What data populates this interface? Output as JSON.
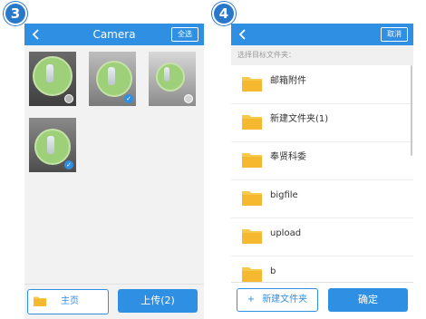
{
  "steps": {
    "left": "3",
    "right": "4"
  },
  "camera_screen": {
    "title": "Camera",
    "select_all": "全选",
    "photos": [
      {
        "selected": false
      },
      {
        "selected": true
      },
      {
        "selected": false
      },
      {
        "selected": true
      }
    ],
    "home_label": "主页",
    "upload_label": "上传(2)"
  },
  "folder_screen": {
    "cancel_label": "取消",
    "section_label": "选择目标文件夹：",
    "folders": [
      {
        "name": "邮箱附件"
      },
      {
        "name": "新建文件夹(1)"
      },
      {
        "name": "奉贤科委"
      },
      {
        "name": "bigfile"
      },
      {
        "name": "upload"
      },
      {
        "name": "b"
      }
    ],
    "new_folder_label": "新建文件夹",
    "confirm_label": "确定"
  },
  "colors": {
    "accent": "#2f8fe3",
    "folder": "#f7c948"
  },
  "icons": {
    "back": "chevron-left-icon",
    "folder": "folder-icon",
    "check": "checkmark-icon",
    "plus": "plus-icon"
  }
}
